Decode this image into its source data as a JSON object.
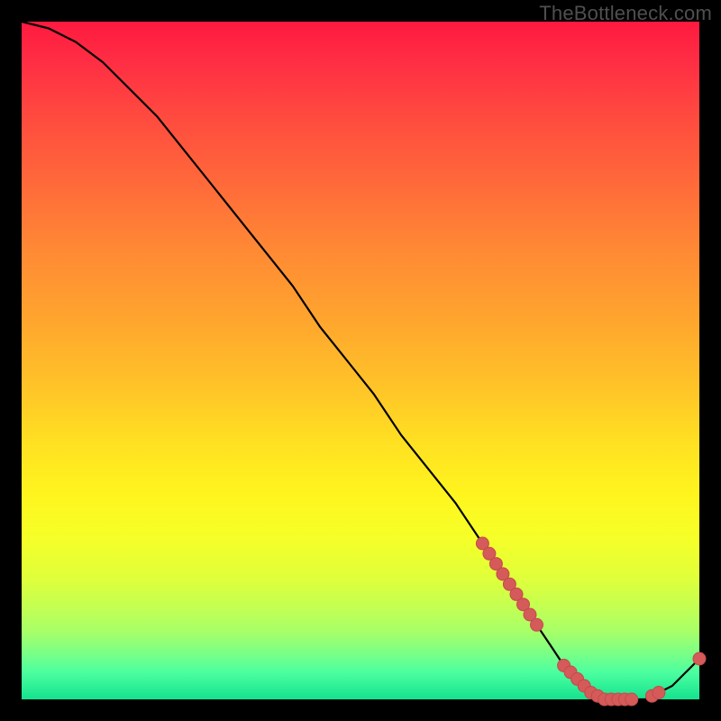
{
  "watermark": "TheBottleneck.com",
  "colors": {
    "background": "#000000",
    "curve_stroke": "#000000",
    "marker_fill": "#d55a5a",
    "marker_stroke": "#c44a4a"
  },
  "chart_data": {
    "type": "line",
    "title": "",
    "xlabel": "",
    "ylabel": "",
    "xlim": [
      0,
      100
    ],
    "ylim": [
      0,
      100
    ],
    "grid": false,
    "series": [
      {
        "name": "curve",
        "x": [
          0,
          4,
          8,
          12,
          16,
          20,
          24,
          28,
          32,
          36,
          40,
          44,
          48,
          52,
          56,
          60,
          64,
          68,
          70,
          72,
          74,
          76,
          78,
          80,
          82,
          84,
          86,
          88,
          90,
          92,
          94,
          96,
          98,
          100
        ],
        "y": [
          100,
          99,
          97,
          94,
          90,
          86,
          81,
          76,
          71,
          66,
          61,
          55,
          50,
          45,
          39,
          34,
          29,
          23,
          20,
          17,
          14,
          11,
          8,
          5,
          3,
          1,
          0,
          0,
          0,
          0,
          1,
          2,
          4,
          6
        ]
      }
    ],
    "markers": [
      {
        "name": "cluster-descent",
        "x": [
          68,
          69,
          70,
          71,
          72,
          73,
          74,
          75,
          76
        ],
        "y": [
          23,
          21.5,
          20,
          18.5,
          17,
          15.5,
          14,
          12.5,
          11
        ]
      },
      {
        "name": "cluster-valley",
        "x": [
          80,
          81,
          82,
          83,
          84,
          85,
          86,
          87,
          88,
          89,
          90,
          93,
          94,
          100
        ],
        "y": [
          5,
          4,
          3,
          2,
          1,
          0.5,
          0,
          0,
          0,
          0,
          0,
          0.5,
          1,
          6
        ]
      }
    ]
  }
}
